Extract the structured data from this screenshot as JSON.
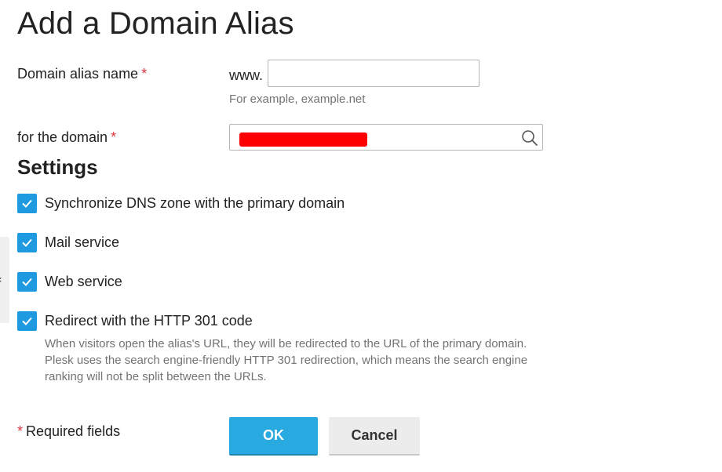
{
  "page": {
    "title": "Add a Domain Alias"
  },
  "form": {
    "alias_name": {
      "label": "Domain alias name",
      "required_mark": "*",
      "prefix": "www.",
      "value": "",
      "hint": "For example, example.net"
    },
    "for_domain": {
      "label": "for the domain",
      "required_mark": "*",
      "value_redacted": true,
      "redaction_color": "#ff0000",
      "icon": "search-icon"
    }
  },
  "settings": {
    "title": "Settings",
    "options": [
      {
        "label": "Synchronize DNS zone with the primary domain",
        "checked": true
      },
      {
        "label": "Mail service",
        "checked": true
      },
      {
        "label": "Web service",
        "checked": true
      },
      {
        "label": "Redirect with the HTTP 301 code",
        "checked": true
      }
    ],
    "redirect_description": "When visitors open the alias's URL, they will be redirected to the URL of the primary domain. Plesk uses the search engine-friendly HTTP 301 redirection, which means the search engine ranking will not be split between the URLs."
  },
  "footer": {
    "required_mark": "*",
    "required_note": "Required fields",
    "ok_label": "OK",
    "cancel_label": "Cancel"
  },
  "colors": {
    "checkbox": "#1f9ae0",
    "ok_button": "#28a9df",
    "required_mark": "#d9363e"
  }
}
